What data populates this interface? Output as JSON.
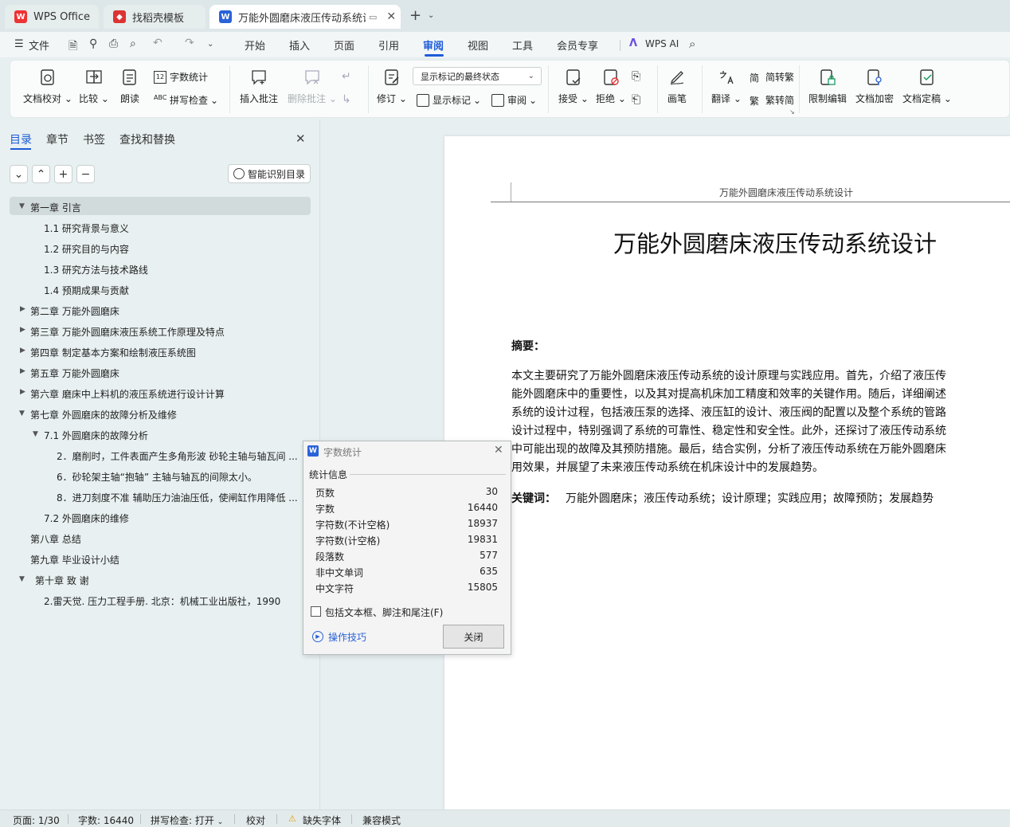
{
  "tabs": [
    {
      "label": "WPS Office"
    },
    {
      "label": "找稻壳模板"
    },
    {
      "label": "万能外圆磨床液压传动系统设计"
    }
  ],
  "menu": {
    "file": "文件",
    "items": [
      "开始",
      "插入",
      "页面",
      "引用",
      "审阅",
      "视图",
      "工具",
      "会员专享"
    ],
    "active": "审阅",
    "ai": "WPS AI"
  },
  "ribbon": {
    "doc_check": "文档校对",
    "compare": "比较",
    "read_aloud": "朗读",
    "word_count": "字数统计",
    "spell_check": "拼写检查",
    "insert_comment": "插入批注",
    "delete_comment": "删除批注",
    "track_changes": "修订",
    "markup_state": "显示标记的最终状态",
    "show_markup": "显示标记",
    "review": "审阅",
    "accept": "接受",
    "reject": "拒绝",
    "pen": "画笔",
    "translate": "翻译",
    "to_traditional": "简转繁",
    "to_simplified": "繁转简",
    "restrict_edit": "限制编辑",
    "encrypt": "文档加密",
    "finalize": "文档定稿"
  },
  "nav": {
    "tabs": [
      "目录",
      "章节",
      "书签",
      "查找和替换"
    ],
    "smart_toc": "智能识别目录",
    "toc": [
      "第一章  引言",
      "1.1  研究背景与意义",
      "1.2  研究目的与内容",
      "1.3  研究方法与技术路线",
      "1.4  预期成果与贡献",
      "第二章    万能外圆磨床",
      "第三章    万能外圆磨床液压系统工作原理及特点",
      "第四章  制定基本方案和绘制液压系统图",
      "第五章    万能外圆磨床",
      "第六章  磨床中上料机的液压系统进行设计计算",
      "第七章      外圆磨床的故障分析及维修",
      "7.1    外圆磨床的故障分析",
      "2．磨削时，工件表面产生多角形波  砂轮主轴与轴瓦间 ...",
      "6．砂轮架主轴“抱轴”  主轴与轴瓦的间隙太小。",
      "8．进刀刻度不准  辅助压力油油压低，使闸缸作用降低 ...",
      "7.2    外圆磨床的维修",
      "第八章  总结",
      "第九章      毕业设计小结",
      "第十章      致  谢",
      "2.雷天觉. 压力工程手册. 北京：机械工业出版社，1990"
    ]
  },
  "document": {
    "header": "万能外圆磨床液压传动系统设计",
    "title": "万能外圆磨床液压传动系统设计",
    "abstract_label": "摘要：",
    "abstract_lines": [
      "本文主要研究了万能外圆磨床液压传动系统的设计原理与实践应用。首先，介绍了液压传",
      "能外圆磨床中的重要性，以及其对提高机床加工精度和效率的关键作用。随后，详细阐述",
      "系统的设计过程，包括液压泵的选择、液压缸的设计、液压阀的配置以及整个系统的管路",
      "设计过程中，特别强调了系统的可靠性、稳定性和安全性。此外，还探讨了液压传动系统",
      "中可能出现的故障及其预防措施。最后，结合实例，分析了液压传动系统在万能外圆磨床",
      "用效果，并展望了未来液压传动系统在机床设计中的发展趋势。"
    ],
    "keywords_label": "关键词：",
    "keywords": "万能外圆磨床；液压传动系统；设计原理；实践应用；故障预防；发展趋势"
  },
  "dialog": {
    "title": "字数统计",
    "section": "统计信息",
    "stats": [
      {
        "label": "页数",
        "value": "30"
      },
      {
        "label": "字数",
        "value": "16440"
      },
      {
        "label": "字符数(不计空格)",
        "value": "18937"
      },
      {
        "label": "字符数(计空格)",
        "value": "19831"
      },
      {
        "label": "段落数",
        "value": "577"
      },
      {
        "label": "非中文单词",
        "value": "635"
      },
      {
        "label": "中文字符",
        "value": "15805"
      }
    ],
    "checkbox": "包括文本框、脚注和尾注(F)",
    "tips": "操作技巧",
    "close": "关闭"
  },
  "status": {
    "page": "页面: 1/30",
    "words": "字数: 16440",
    "spell": "拼写检查: 打开",
    "proof": "校对",
    "missing_font": "缺失字体",
    "compat": "兼容模式"
  }
}
